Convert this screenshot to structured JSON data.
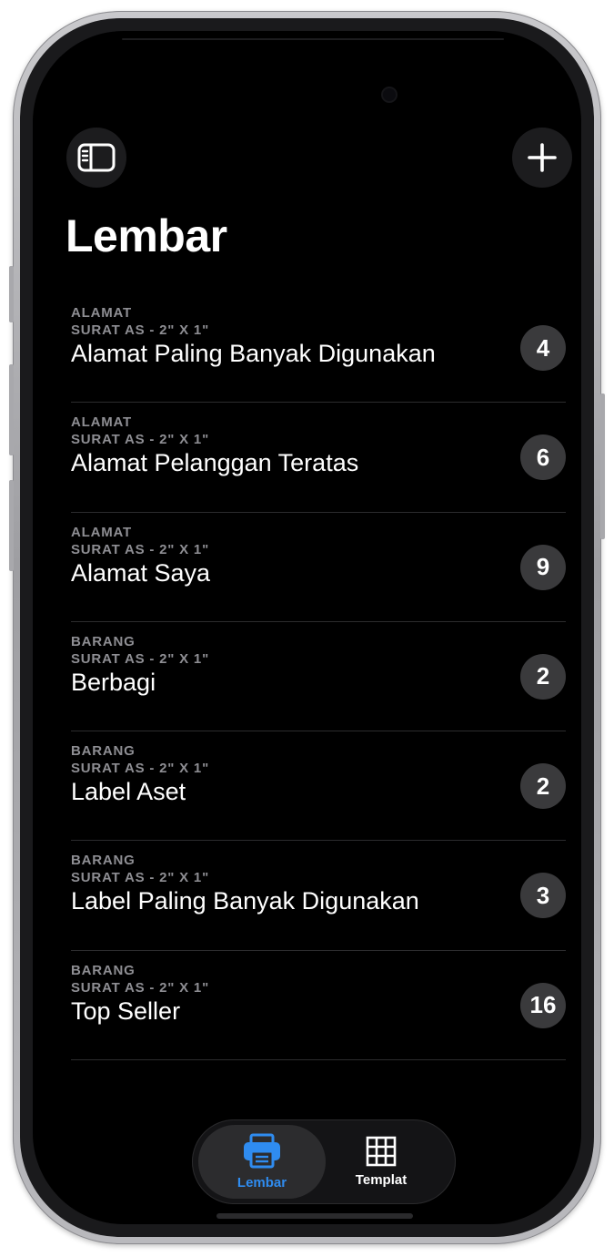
{
  "header": {
    "title": "Lembar",
    "sidebar_icon": "sidebar-icon",
    "add_icon": "plus-icon"
  },
  "sheets": [
    {
      "category": "ALAMAT",
      "size": "SURAT AS - 2\" X 1\"",
      "name": "Alamat Paling Banyak Digunakan",
      "count": "4"
    },
    {
      "category": "ALAMAT",
      "size": "SURAT AS - 2\" X 1\"",
      "name": "Alamat Pelanggan Teratas",
      "count": "6"
    },
    {
      "category": "ALAMAT",
      "size": "SURAT AS - 2\" X 1\"",
      "name": "Alamat Saya",
      "count": "9"
    },
    {
      "category": "BARANG",
      "size": "SURAT AS - 2\" X 1\"",
      "name": "Berbagi",
      "count": "2"
    },
    {
      "category": "BARANG",
      "size": "SURAT AS - 2\" X 1\"",
      "name": "Label Aset",
      "count": "2"
    },
    {
      "category": "BARANG",
      "size": "SURAT AS - 2\" X 1\"",
      "name": "Label Paling Banyak Digunakan",
      "count": "3"
    },
    {
      "category": "BARANG",
      "size": "SURAT AS - 2\" X 1\"",
      "name": "Top Seller",
      "count": "16"
    }
  ],
  "tabbar": {
    "tabs": [
      {
        "label": "Lembar",
        "icon": "printer-icon",
        "active": true
      },
      {
        "label": "Templat",
        "icon": "grid-icon",
        "active": false
      }
    ]
  },
  "colors": {
    "accent": "#2f8cf0",
    "background": "#000000",
    "badge": "#3a3a3c",
    "secondary_text": "#8e8e93"
  }
}
